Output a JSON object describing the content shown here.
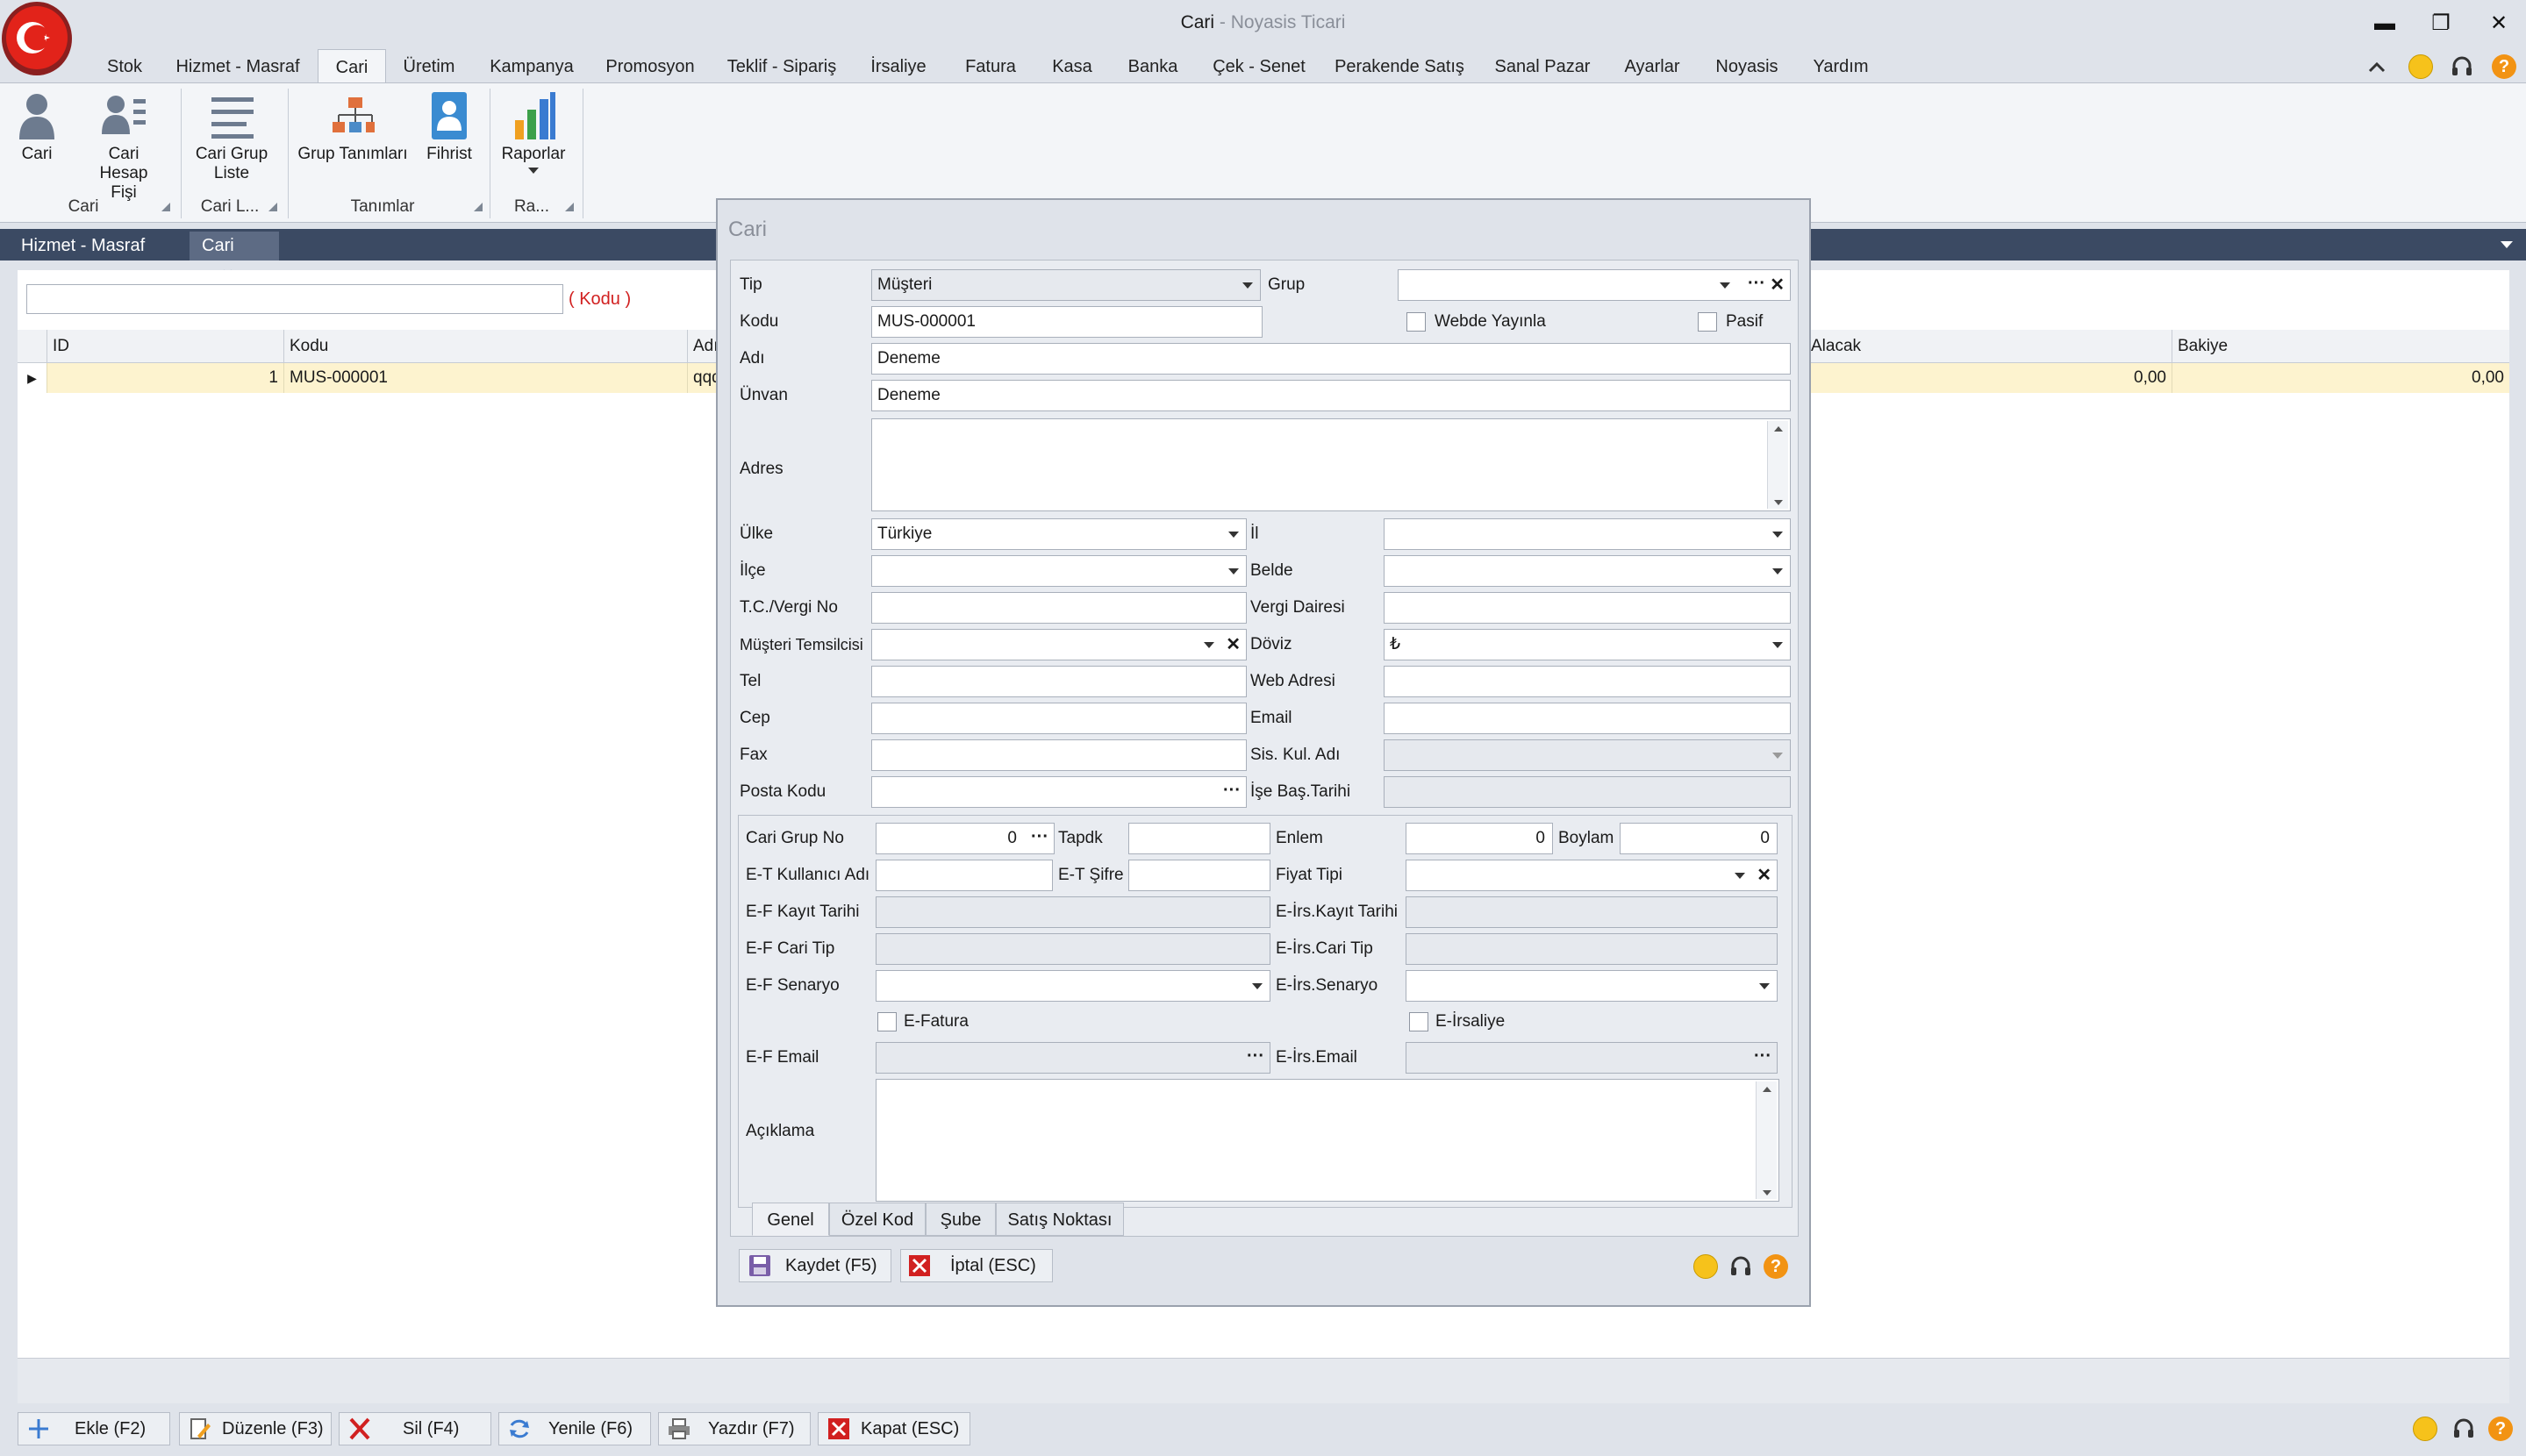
{
  "window": {
    "title": "Cari",
    "subtitle": " - Noyasis Ticari",
    "min": "▬",
    "restore": "❐",
    "close": "✕"
  },
  "menu": [
    "Stok",
    "Hizmet - Masraf",
    "Cari",
    "Üretim",
    "Kampanya",
    "Promosyon",
    "Teklif - Sipariş",
    "İrsaliye",
    "Fatura",
    "Kasa",
    "Banka",
    "Çek - Senet",
    "Perakende Satış",
    "Sanal Pazar",
    "Ayarlar",
    "Noyasis",
    "Yardım"
  ],
  "ribbon": {
    "buttons": [
      {
        "label": "Cari",
        "icon": "person-icon"
      },
      {
        "label": "Cari Hesap Fişi",
        "icon": "account-list-icon"
      },
      {
        "label": "Cari Grup Liste",
        "icon": "list-icon"
      },
      {
        "label": "Grup Tanımları",
        "icon": "hierarchy-icon"
      },
      {
        "label": "Fihrist",
        "icon": "address-book-icon"
      },
      {
        "label": "Raporlar",
        "icon": "bar-chart-icon"
      }
    ],
    "groups": [
      "Cari",
      "Cari L...",
      "Tanımlar",
      "Ra..."
    ]
  },
  "tabs": [
    {
      "label": "Hizmet - Masraf"
    },
    {
      "label": "Cari",
      "close": "✕"
    }
  ],
  "list": {
    "search_value": "",
    "search_hint": "( Kodu )",
    "columns": [
      "ID",
      "Kodu",
      "Adı",
      "Alacak",
      "Bakiye"
    ],
    "rows": [
      {
        "id": "1",
        "kodu": "MUS-000001",
        "adi": "qqqw",
        "alacak": "0,00",
        "bakiye": "0,00"
      }
    ]
  },
  "dialog": {
    "title": "Cari",
    "labels": {
      "tip": "Tip",
      "grup": "Grup",
      "kodu": "Kodu",
      "webde": "Webde Yayınla",
      "pasif": "Pasif",
      "adi": "Adı",
      "unvan": "Ünvan",
      "adres": "Adres",
      "ulke": "Ülke",
      "il": "İl",
      "ilce": "İlçe",
      "belde": "Belde",
      "tc": "T.C./Vergi No",
      "vergi_dairesi": "Vergi Dairesi",
      "temsilci": "Müşteri Temsilcisi",
      "doviz": "Döviz",
      "tel": "Tel",
      "web": "Web Adresi",
      "cep": "Cep",
      "email": "Email",
      "fax": "Fax",
      "sis_kul": "Sis. Kul. Adı",
      "posta": "Posta Kodu",
      "ise_bas": "İşe Baş.Tarihi",
      "cari_grup_no": "Cari Grup No",
      "tapdk": "Tapdk",
      "enlem": "Enlem",
      "boylam": "Boylam",
      "et_kul": "E-T Kullanıcı Adı",
      "et_sifre": "E-T Şifre",
      "fiyat_tipi": "Fiyat Tipi",
      "ef_kayit": "E-F Kayıt Tarihi",
      "eirs_kayit": "E-İrs.Kayıt Tarihi",
      "ef_cari_tip": "E-F Cari Tip",
      "eirs_cari_tip": "E-İrs.Cari Tip",
      "ef_senaryo": "E-F Senaryo",
      "eirs_senaryo": "E-İrs.Senaryo",
      "efatura": "E-Fatura",
      "eirsaliye": "E-İrsaliye",
      "ef_email": "E-F Email",
      "eirs_email": "E-İrs.Email",
      "aciklama": "Açıklama"
    },
    "values": {
      "tip": "Müşteri",
      "kodu": "MUS-000001",
      "adi": "Deneme",
      "unvan": "Deneme",
      "ulke": "Türkiye",
      "doviz": "₺",
      "cari_grup_no": "0",
      "enlem": "0",
      "boylam": "0"
    },
    "subtabs": [
      "Genel",
      "Özel Kod",
      "Şube",
      "Satış Noktası"
    ],
    "buttons": {
      "save": "Kaydet (F5)",
      "cancel": "İptal (ESC)"
    },
    "ellipsis": "···",
    "clear": "✕"
  },
  "toolbar": [
    "Ekle (F2)",
    "Düzenle (F3)",
    "Sil (F4)",
    "Yenile (F6)",
    "Yazdır (F7)",
    "Kapat (ESC)"
  ],
  "status_help": "?"
}
